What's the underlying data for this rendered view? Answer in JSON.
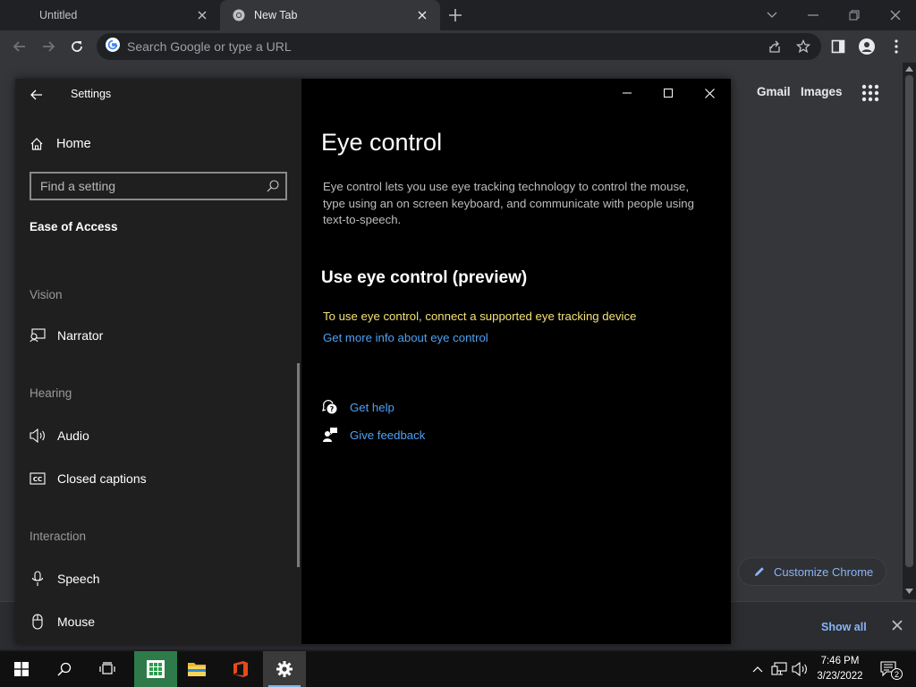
{
  "browser": {
    "tabs": [
      {
        "title": "Untitled",
        "active": false
      },
      {
        "title": "New Tab",
        "active": true
      }
    ],
    "omnibox": {
      "placeholder": "Search Google or type a URL",
      "value": ""
    },
    "ntp": {
      "gmail_label": "Gmail",
      "images_label": "Images",
      "customize_label": "Customize Chrome"
    },
    "downloads_bar": {
      "show_all_label": "Show all"
    }
  },
  "settings": {
    "window_title": "Settings",
    "home_label": "Home",
    "search_placeholder": "Find a setting",
    "category": "Ease of Access",
    "groups": {
      "vision": "Vision",
      "hearing": "Hearing",
      "interaction": "Interaction"
    },
    "nav_items": {
      "narrator": "Narrator",
      "audio": "Audio",
      "closed_captions": "Closed captions",
      "speech": "Speech",
      "mouse": "Mouse"
    },
    "page": {
      "title": "Eye control",
      "description": "Eye control lets you use eye tracking technology to control the mouse, type using an on screen keyboard, and communicate with people using text-to-speech.",
      "section_title": "Use eye control (preview)",
      "warning": "To use eye control, connect a supported eye tracking device",
      "more_info_link": "Get more info about eye control",
      "get_help": "Get help",
      "give_feedback": "Give feedback"
    }
  },
  "taskbar": {
    "time": "7:46 PM",
    "date": "3/23/2022",
    "notification_count": "2"
  },
  "colors": {
    "link_blue": "#4ea1f3",
    "warning_yellow": "#f5e078",
    "chrome_link": "#8ab4f8",
    "taskbar_accent": "#7cb7ea"
  }
}
